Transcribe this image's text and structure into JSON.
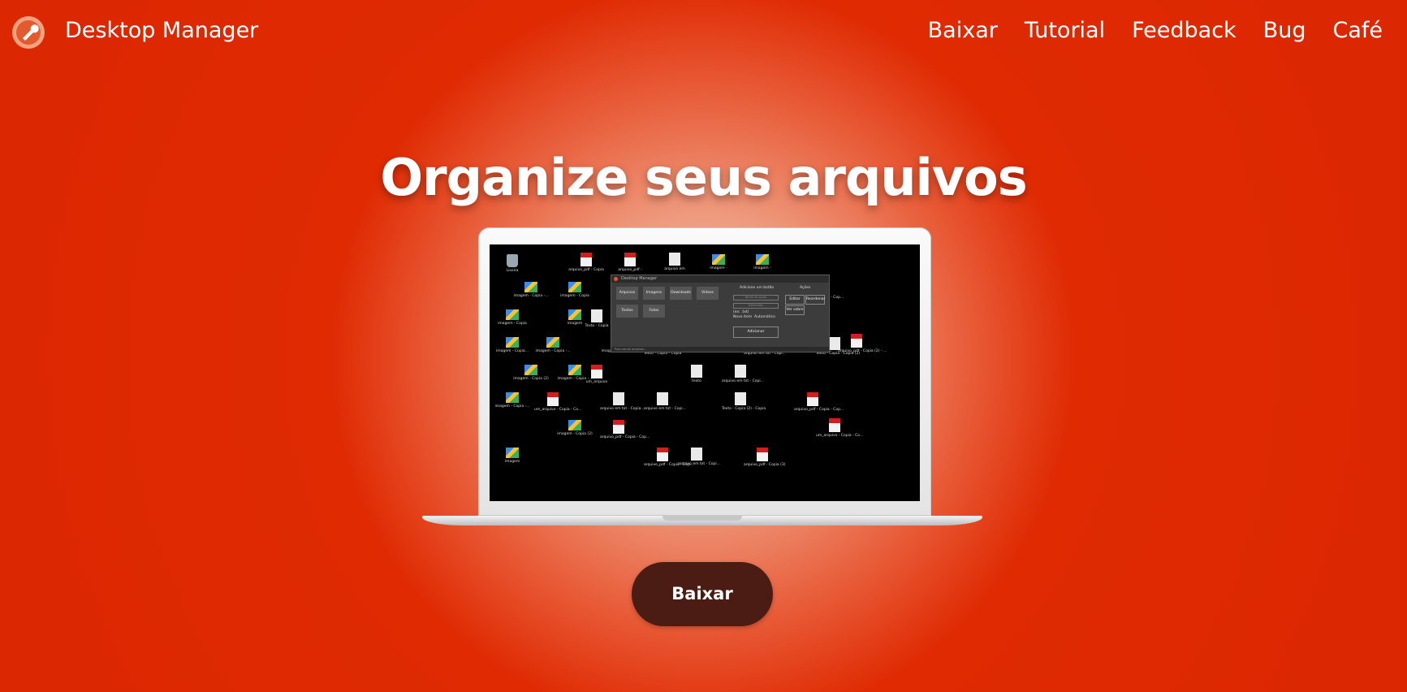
{
  "header": {
    "brand": "Desktop Manager",
    "logo_icon": "wrench-gear-icon",
    "nav": [
      "Baixar",
      "Tutorial",
      "Feedback",
      "Bug",
      "Café"
    ]
  },
  "hero": {
    "title": "Organize seus arquivos",
    "cta_label": "Baixar"
  },
  "screenshot": {
    "desktop_icons": [
      {
        "label": "Lixeira",
        "kind": "trash"
      },
      {
        "label": "arquivo_pdf - Copia",
        "kind": "pdf"
      },
      {
        "label": "arquivo_pdf -",
        "kind": "pdf"
      },
      {
        "label": "arquivo em",
        "kind": "txt"
      },
      {
        "label": "imagem -",
        "kind": "img"
      },
      {
        "label": "imagem -",
        "kind": "img"
      },
      {
        "label": "imagem - Copia -...",
        "kind": "img"
      },
      {
        "label": "imagem - Copia",
        "kind": "img"
      },
      {
        "label": "arquivo_pdf - Copia - Cop...",
        "kind": "pdf"
      },
      {
        "label": "imagem - Copia",
        "kind": "img"
      },
      {
        "label": "imagem",
        "kind": "img"
      },
      {
        "label": "Texto - Copia",
        "kind": "txt"
      },
      {
        "label": "imagem - Copia...",
        "kind": "img"
      },
      {
        "label": "imagem - Copia -...",
        "kind": "img"
      },
      {
        "label": "imagem - Copia -...",
        "kind": "img"
      },
      {
        "label": "Texto - Copia - Copia",
        "kind": "txt"
      },
      {
        "label": "arquivo em txt - Copi...",
        "kind": "txt"
      },
      {
        "label": "Texto - Copia - Copia (2)",
        "kind": "txt"
      },
      {
        "label": "arquivo_pdf - Copia (2) - ...",
        "kind": "pdf"
      },
      {
        "label": "imagem - Copia (2)",
        "kind": "img"
      },
      {
        "label": "imagem - Copia -...",
        "kind": "img"
      },
      {
        "label": "um_arquivo",
        "kind": "pdf"
      },
      {
        "label": "texto",
        "kind": "txt"
      },
      {
        "label": "arquivo em txt - Copi...",
        "kind": "txt"
      },
      {
        "label": "imagem - Copia -...",
        "kind": "img"
      },
      {
        "label": "um_arquivo - Copia - Co...",
        "kind": "pdf"
      },
      {
        "label": "arquivo em txt - Copia...",
        "kind": "txt"
      },
      {
        "label": "arquivo em txt - Copi...",
        "kind": "txt"
      },
      {
        "label": "Texto - Copia (2) - Copia",
        "kind": "txt"
      },
      {
        "label": "arquivo_pdf - Copia - Cop...",
        "kind": "pdf"
      },
      {
        "label": "imagem - Copia (2)",
        "kind": "img"
      },
      {
        "label": "arquivo_pdf - Copia - Cop...",
        "kind": "pdf"
      },
      {
        "label": "um_arquivo - Copia - Co...",
        "kind": "pdf"
      },
      {
        "label": "imagem",
        "kind": "img"
      },
      {
        "label": "arquivo_pdf - Copia - Cop...",
        "kind": "pdf"
      },
      {
        "label": "arquivo em txt - Copi...",
        "kind": "txt"
      },
      {
        "label": "arquivo_pdf - Copia (3)",
        "kind": "pdf"
      }
    ],
    "app_window": {
      "title": "Desktop Manager",
      "buttons": [
        "Arquivos",
        "Imagens",
        "Downloads",
        "Vídeos",
        "Textos",
        "Fotos"
      ],
      "panel_title": "Adicione um botão",
      "field_name": "Nome da pasta",
      "field_ext": "Extensões",
      "check_1": "(ex: .txt)",
      "check_2": "Novo item",
      "check_3": "Automático",
      "add_button": "Adicionar",
      "actions_title": "Ações",
      "action_1": "Editar",
      "action_2": "Reordenar",
      "action_3": "Ver sobre",
      "status": "Procurando arquivos..."
    }
  }
}
